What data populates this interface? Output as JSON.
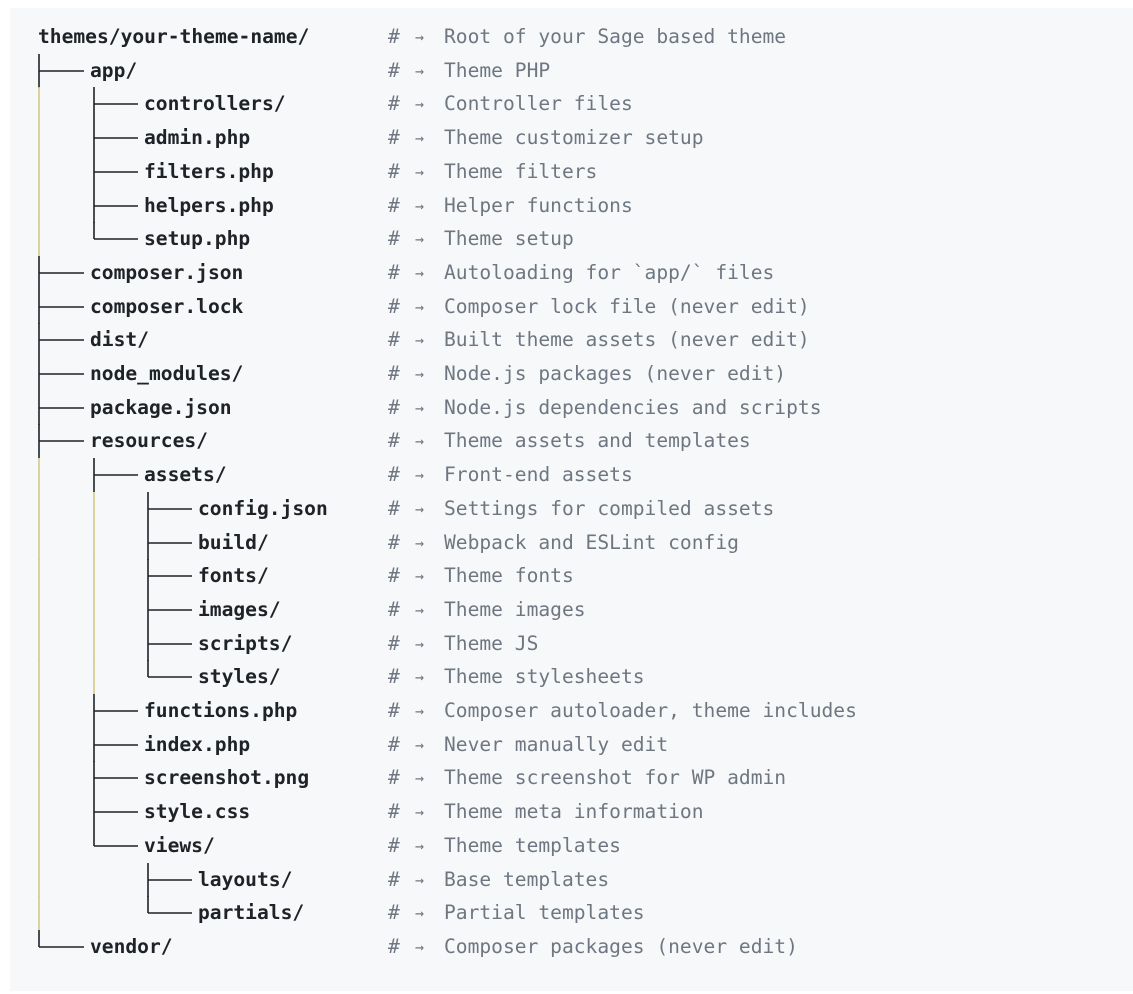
{
  "tree": [
    {
      "depth": 0,
      "last": false,
      "name": "themes/your-theme-name/",
      "comment": "Root of your Sage based theme"
    },
    {
      "depth": 1,
      "last": false,
      "name": "app/",
      "comment": "Theme PHP"
    },
    {
      "depth": 2,
      "last": false,
      "name": "controllers/",
      "comment": "Controller files"
    },
    {
      "depth": 2,
      "last": false,
      "name": "admin.php",
      "comment": "Theme customizer setup"
    },
    {
      "depth": 2,
      "last": false,
      "name": "filters.php",
      "comment": "Theme filters"
    },
    {
      "depth": 2,
      "last": false,
      "name": "helpers.php",
      "comment": "Helper functions"
    },
    {
      "depth": 2,
      "last": true,
      "name": "setup.php",
      "comment": "Theme setup"
    },
    {
      "depth": 1,
      "last": false,
      "name": "composer.json",
      "comment": "Autoloading for `app/` files"
    },
    {
      "depth": 1,
      "last": false,
      "name": "composer.lock",
      "comment": "Composer lock file (never edit)"
    },
    {
      "depth": 1,
      "last": false,
      "name": "dist/",
      "comment": "Built theme assets (never edit)"
    },
    {
      "depth": 1,
      "last": false,
      "name": "node_modules/",
      "comment": "Node.js packages (never edit)"
    },
    {
      "depth": 1,
      "last": false,
      "name": "package.json",
      "comment": "Node.js dependencies and scripts"
    },
    {
      "depth": 1,
      "last": false,
      "name": "resources/",
      "comment": "Theme assets and templates"
    },
    {
      "depth": 2,
      "last": false,
      "name": "assets/",
      "comment": "Front-end assets"
    },
    {
      "depth": 3,
      "last": false,
      "name": "config.json",
      "comment": "Settings for compiled assets"
    },
    {
      "depth": 3,
      "last": false,
      "name": "build/",
      "comment": "Webpack and ESLint config"
    },
    {
      "depth": 3,
      "last": false,
      "name": "fonts/",
      "comment": "Theme fonts"
    },
    {
      "depth": 3,
      "last": false,
      "name": "images/",
      "comment": "Theme images"
    },
    {
      "depth": 3,
      "last": false,
      "name": "scripts/",
      "comment": "Theme JS"
    },
    {
      "depth": 3,
      "last": true,
      "name": "styles/",
      "comment": "Theme stylesheets"
    },
    {
      "depth": 2,
      "last": false,
      "name": "functions.php",
      "comment": "Composer autoloader, theme includes"
    },
    {
      "depth": 2,
      "last": false,
      "name": "index.php",
      "comment": "Never manually edit"
    },
    {
      "depth": 2,
      "last": false,
      "name": "screenshot.png",
      "comment": "Theme screenshot for WP admin"
    },
    {
      "depth": 2,
      "last": false,
      "name": "style.css",
      "comment": "Theme meta information"
    },
    {
      "depth": 2,
      "last": true,
      "name": "views/",
      "comment": "Theme templates"
    },
    {
      "depth": 3,
      "last": false,
      "name": "layouts/",
      "comment": "Base templates"
    },
    {
      "depth": 3,
      "last": true,
      "name": "partials/",
      "comment": "Partial templates"
    },
    {
      "depth": 1,
      "last": true,
      "name": "vendor/",
      "comment": "Composer packages (never edit)"
    }
  ],
  "comment_prefix": "#",
  "comment_arrow": "→",
  "colors": {
    "background": "#f6f8fa",
    "name_text": "#1f2328",
    "comment_text": "#6e7781",
    "guide_vertical": "#d4c98a",
    "guide_branch": "#1f2328"
  }
}
